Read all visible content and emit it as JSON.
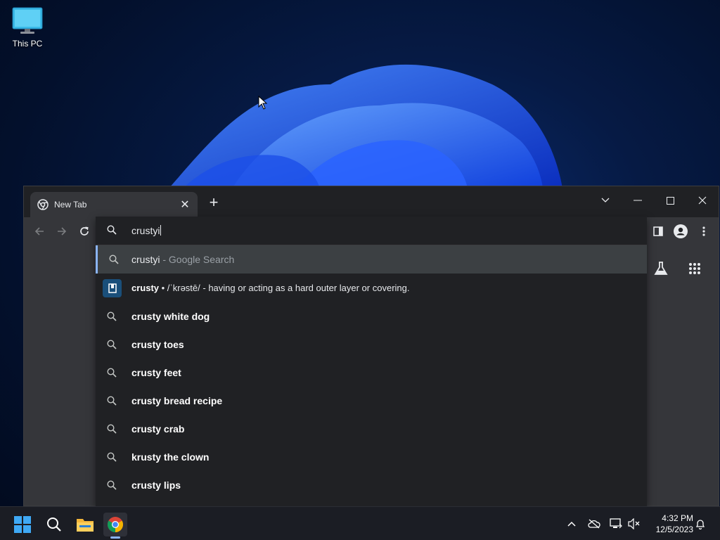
{
  "desktop": {
    "icons": [
      {
        "label": "This PC",
        "icon": "monitor-icon"
      }
    ]
  },
  "browser": {
    "tab": {
      "title": "New Tab",
      "icon": "chrome-icon"
    },
    "omnibox": {
      "value": "crustyi",
      "suggestions": [
        {
          "type": "search-what-you-typed",
          "bold": "crustyi",
          "rest": " - Google Search",
          "icon": "search-icon"
        },
        {
          "type": "dictionary",
          "bold": "crusty",
          "pron": " • /ˈkrəstē/",
          "rest": " -  having or acting as a hard outer layer or covering.",
          "icon": "dictionary-icon"
        },
        {
          "type": "search",
          "bold": "crusty white dog",
          "icon": "search-icon"
        },
        {
          "type": "search",
          "bold": "crusty toes",
          "icon": "search-icon"
        },
        {
          "type": "search",
          "bold": "crusty feet",
          "icon": "search-icon"
        },
        {
          "type": "search",
          "bold": "crusty bread recipe",
          "icon": "search-icon"
        },
        {
          "type": "search",
          "bold": "crusty crab",
          "icon": "search-icon"
        },
        {
          "type": "search",
          "bold": "krusty the clown",
          "icon": "search-icon"
        },
        {
          "type": "search",
          "bold": "crusty lips",
          "icon": "search-icon"
        }
      ]
    }
  },
  "taskbar": {
    "clock": {
      "time": "4:32 PM",
      "date": "12/5/2023"
    }
  },
  "colors": {
    "accent": "#8ab4f8",
    "tab_bg": "#35363a",
    "dropdown_bg": "#202124"
  }
}
